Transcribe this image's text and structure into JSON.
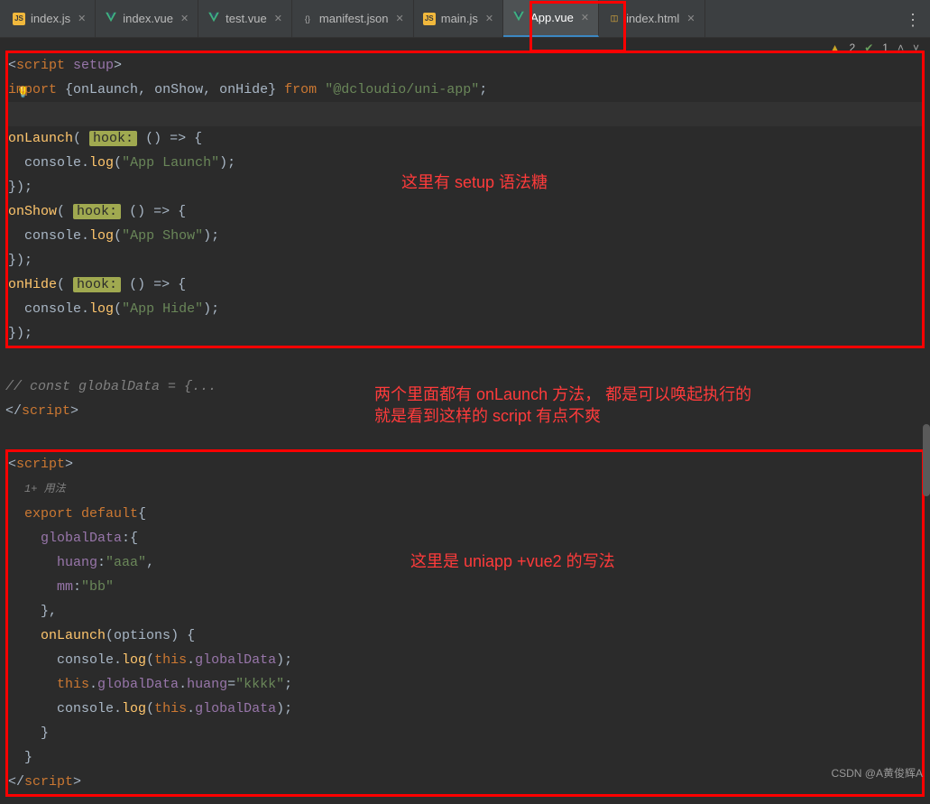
{
  "tabs": [
    {
      "label": "index.js",
      "icon": "js"
    },
    {
      "label": "index.vue",
      "icon": "vue"
    },
    {
      "label": "test.vue",
      "icon": "vue"
    },
    {
      "label": "manifest.json",
      "icon": "json"
    },
    {
      "label": "main.js",
      "icon": "js"
    },
    {
      "label": "App.vue",
      "icon": "vue",
      "active": true
    },
    {
      "label": "index.html",
      "icon": "html"
    }
  ],
  "status": {
    "warn_count": "2",
    "check_count": "1"
  },
  "annotations": {
    "a1": "这里有 setup 语法糖",
    "a2_line1": "两个里面都有 onLaunch 方法，     都是可以唤起执行的",
    "a2_line2": "就是看到这样的 script 有点不爽",
    "a3": "这里是 uniapp +vue2 的写法"
  },
  "code": {
    "setup_open": "<script setup>",
    "import_kw": "import",
    "import_names": {
      "n1": "onLaunch",
      "n2": "onShow",
      "n3": "onHide"
    },
    "from_kw": "from",
    "import_pkg": "\"@dcloudio/uni-app\"",
    "hook_label": "hook:",
    "arrow": "() => {",
    "console": "console",
    "log": "log",
    "msg_launch": "\"App Launch\"",
    "msg_show": "\"App Show\"",
    "msg_hide": "\"App Hide\"",
    "close_fn": "});",
    "comment_global": "// const globalData = {...",
    "script_close": "</script>",
    "script2_open": "<script>",
    "usage": "1+ 用法",
    "export_kw": "export ",
    "default_kw": "default",
    "globalData_key": "globalData",
    "huang_key": "huang",
    "huang_val": "\"aaa\"",
    "mm_key": "mm",
    "mm_val": "\"bb\"",
    "onLaunch_key": "onLaunch",
    "options": "options",
    "this_kw": "this",
    "globalData_prop": "globalData",
    "huang_prop": "huang",
    "assign_val": "\"kkkk\""
  },
  "watermark": "CSDN @A黄俊辉A"
}
